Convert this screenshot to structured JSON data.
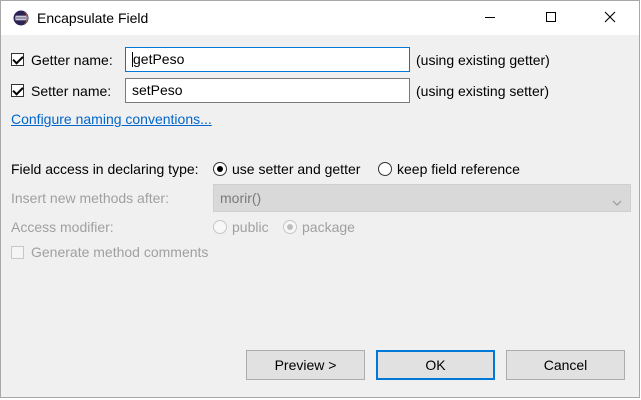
{
  "window": {
    "title": "Encapsulate Field"
  },
  "getter": {
    "checkbox_label": "Getter name:",
    "checked": true,
    "value": "getPeso",
    "note": "(using existing getter)"
  },
  "setter": {
    "checkbox_label": "Setter name:",
    "checked": true,
    "value": "setPeso",
    "note": "(using existing setter)"
  },
  "configure_link": "Configure naming conventions...",
  "field_access": {
    "label": "Field access in declaring type:",
    "options": [
      {
        "label": "use setter and getter",
        "selected": true
      },
      {
        "label": "keep field reference",
        "selected": false
      }
    ]
  },
  "insert_after": {
    "label": "Insert new methods after:",
    "value": "morir()",
    "enabled": false
  },
  "access_modifier": {
    "label": "Access modifier:",
    "options": [
      {
        "label": "public",
        "selected": false
      },
      {
        "label": "package",
        "selected": true
      }
    ],
    "enabled": false
  },
  "generate_comments": {
    "label": "Generate method comments",
    "checked": false,
    "enabled": false
  },
  "buttons": {
    "preview": "Preview >",
    "ok": "OK",
    "cancel": "Cancel"
  },
  "colors": {
    "accent": "#0078d7",
    "link": "#0066cc",
    "disabled_text": "#a0a0a0",
    "dialog_bg": "#f0f0f0"
  },
  "icons": {
    "app": "eclipse-icon",
    "minimize": "minimize-icon",
    "maximize": "maximize-icon",
    "close": "close-icon",
    "combo": "chevron-down-icon"
  }
}
